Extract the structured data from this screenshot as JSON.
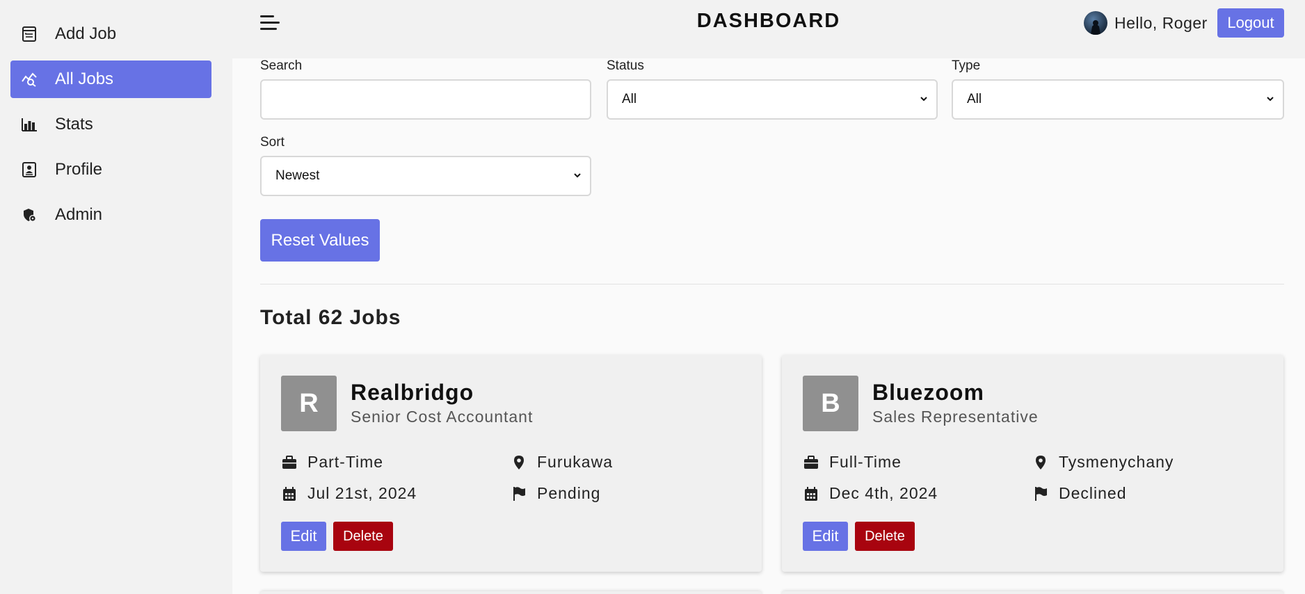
{
  "sidebar": {
    "items": [
      {
        "label": "Add Job",
        "icon": "add-job-icon"
      },
      {
        "label": "All Jobs",
        "icon": "all-jobs-icon",
        "active": true
      },
      {
        "label": "Stats",
        "icon": "stats-icon"
      },
      {
        "label": "Profile",
        "icon": "profile-icon"
      },
      {
        "label": "Admin",
        "icon": "admin-icon"
      }
    ]
  },
  "header": {
    "title": "DASHBOARD",
    "greeting": "Hello, Roger",
    "logout_label": "Logout"
  },
  "filters": {
    "search_label": "Search",
    "search_value": "",
    "status_label": "Status",
    "status_value": "All",
    "type_label": "Type",
    "type_value": "All",
    "sort_label": "Sort",
    "sort_value": "Newest",
    "reset_label": "Reset Values"
  },
  "total_label": "Total 62 Jobs",
  "jobs": [
    {
      "initial": "R",
      "company": "Realbridgo",
      "position": "Senior Cost Accountant",
      "type": "Part-Time",
      "location": "Furukawa",
      "date": "Jul 21st, 2024",
      "status": "Pending",
      "edit_label": "Edit",
      "delete_label": "Delete"
    },
    {
      "initial": "B",
      "company": "Bluezoom",
      "position": "Sales Representative",
      "type": "Full-Time",
      "location": "Tysmenychany",
      "date": "Dec 4th, 2024",
      "status": "Declined",
      "edit_label": "Edit",
      "delete_label": "Delete"
    }
  ],
  "colors": {
    "accent": "#6772e5",
    "danger": "#a8040f",
    "logo_bg": "#909090"
  }
}
